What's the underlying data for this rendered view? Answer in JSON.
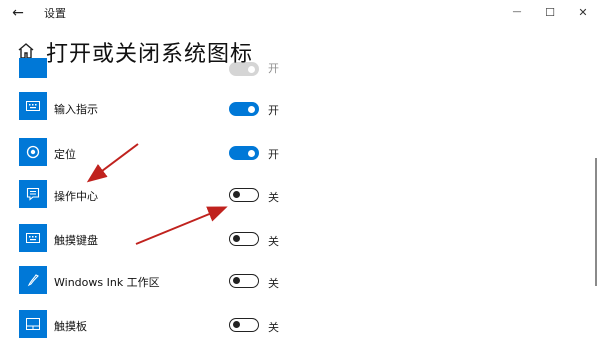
{
  "window": {
    "title": "设置",
    "back_glyph": "←",
    "minimize_glyph": "—",
    "maximize_glyph": "☐",
    "close_glyph": "✕"
  },
  "page": {
    "title": "打开或关闭系统图标"
  },
  "items": [
    {
      "label": "",
      "state": "开",
      "on": true,
      "icon": "unknown-icon",
      "partial": true
    },
    {
      "label": "输入指示",
      "state": "开",
      "on": true,
      "icon": "keyboard-indicator-icon"
    },
    {
      "label": "定位",
      "state": "开",
      "on": true,
      "icon": "location-icon"
    },
    {
      "label": "操作中心",
      "state": "关",
      "on": false,
      "icon": "action-center-icon"
    },
    {
      "label": "触摸键盘",
      "state": "关",
      "on": false,
      "icon": "touch-keyboard-icon"
    },
    {
      "label": "Windows Ink 工作区",
      "state": "关",
      "on": false,
      "icon": "pen-icon"
    },
    {
      "label": "触摸板",
      "state": "关",
      "on": false,
      "icon": "touchpad-icon"
    }
  ],
  "colors": {
    "accent": "#0078d7",
    "arrow": "#c0221e"
  }
}
